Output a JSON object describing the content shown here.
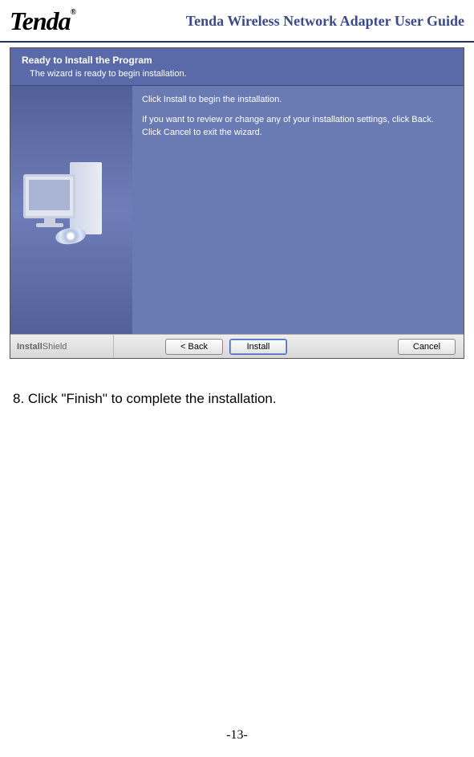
{
  "header": {
    "logo_text": "Tenda",
    "logo_trademark": "®",
    "guide_title": "Tenda Wireless Network Adapter User Guide"
  },
  "installer": {
    "title": "Ready to Install the Program",
    "subtitle": "The wizard is ready to begin installation.",
    "body_line1": "Click Install to begin the installation.",
    "body_line2": "If you want to review or change any of your installation settings, click Back. Click Cancel to exit the wizard.",
    "brand_install": "Install",
    "brand_shield": "Shield",
    "buttons": {
      "back": "< Back",
      "install": "Install",
      "cancel": "Cancel"
    }
  },
  "document": {
    "step_text": "8. Click \"Finish\" to complete the installation.",
    "page_number": "-13-"
  }
}
